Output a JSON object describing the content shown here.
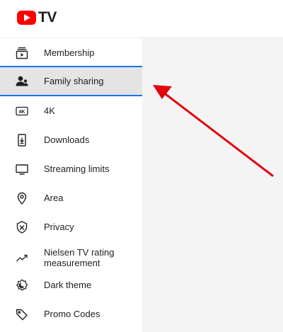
{
  "app": {
    "logo_text": "TV",
    "brand_color": "#ff0000"
  },
  "sidebar": {
    "items": [
      {
        "label": "Membership",
        "icon": "membership-icon",
        "active": false
      },
      {
        "label": "Family sharing",
        "icon": "family-sharing-icon",
        "active": true
      },
      {
        "label": "4K",
        "icon": "4k-icon",
        "active": false
      },
      {
        "label": "Downloads",
        "icon": "downloads-icon",
        "active": false
      },
      {
        "label": "Streaming limits",
        "icon": "tv-monitor-icon",
        "active": false
      },
      {
        "label": "Area",
        "icon": "location-pin-icon",
        "active": false
      },
      {
        "label": "Privacy",
        "icon": "shield-icon",
        "active": false
      },
      {
        "label": "Nielsen TV rating measurement",
        "icon": "trending-up-icon",
        "active": false
      },
      {
        "label": "Dark theme",
        "icon": "dark-theme-icon",
        "active": false
      },
      {
        "label": "Promo Codes",
        "icon": "tag-icon",
        "active": false
      }
    ]
  },
  "colors": {
    "active_border": "#1a73e8",
    "active_background": "#e4e4e4",
    "main_background": "#f4f4f4",
    "annotation_arrow": "#e3000f"
  }
}
